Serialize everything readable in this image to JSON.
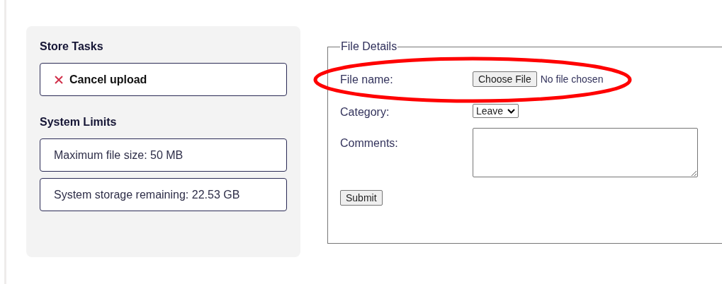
{
  "sidebar": {
    "sections": [
      {
        "title": "Store Tasks",
        "items": [
          {
            "kind": "action",
            "label": "Cancel upload"
          }
        ]
      },
      {
        "title": "System Limits",
        "items": [
          {
            "kind": "info",
            "label": "Maximum file size: 50 MB"
          },
          {
            "kind": "info",
            "label": "System storage remaining: 22.53 GB"
          }
        ]
      }
    ]
  },
  "form": {
    "legend": "File Details",
    "fields": [
      {
        "kind": "file",
        "label": "File name:",
        "button": "Choose File",
        "status": "No file chosen"
      },
      {
        "kind": "select",
        "label": "Category:",
        "value": "Leave"
      },
      {
        "kind": "textarea",
        "label": "Comments:"
      }
    ],
    "submit": "Submit"
  },
  "annotation": {
    "kind": "ellipse",
    "color": "#ff0000"
  }
}
